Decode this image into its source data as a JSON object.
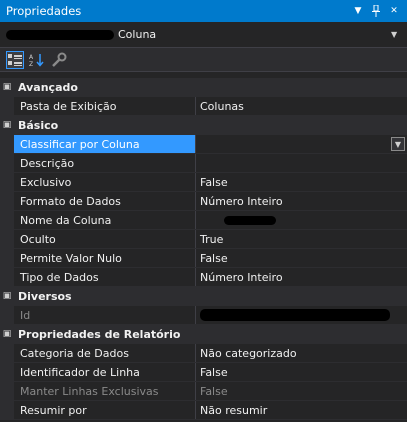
{
  "window": {
    "title": "Propriedades"
  },
  "selector": {
    "label": "Coluna"
  },
  "icons": {
    "pin": "pin-icon",
    "close": "close-icon",
    "dropdown": "chevron-down-icon",
    "categorized": "categorized-view-icon",
    "alphabetical": "alphabetical-sort-icon",
    "property_pages": "property-pages-icon"
  },
  "grid": {
    "avancado": {
      "label": "Avançado",
      "pasta_exibicao": {
        "name": "Pasta de Exibição",
        "value": "Colunas"
      }
    },
    "basico": {
      "label": "Básico",
      "classificar": {
        "name": "Classificar por Coluna",
        "value": ""
      },
      "descricao": {
        "name": "Descrição",
        "value": ""
      },
      "exclusivo": {
        "name": "Exclusivo",
        "value": "False"
      },
      "formato": {
        "name": "Formato de Dados",
        "value": "Número Inteiro"
      },
      "nome": {
        "name": "Nome da Coluna",
        "value": ""
      },
      "oculto": {
        "name": "Oculto",
        "value": "True"
      },
      "permite_nulo": {
        "name": "Permite Valor Nulo",
        "value": "False"
      },
      "tipo": {
        "name": "Tipo de Dados",
        "value": "Número Inteiro"
      }
    },
    "diversos": {
      "label": "Diversos",
      "id": {
        "name": "Id",
        "value": ""
      }
    },
    "relatorio": {
      "label": "Propriedades de Relatório",
      "categoria": {
        "name": "Categoria de Dados",
        "value": "Não categorizado"
      },
      "identificador": {
        "name": "Identificador de Linha",
        "value": "False"
      },
      "manter": {
        "name": "Manter Linhas Exclusivas",
        "value": "False"
      },
      "resumir": {
        "name": "Resumir por",
        "value": "Não resumir"
      }
    }
  },
  "colors": {
    "accent": "#007acc",
    "selection": "#3399ff",
    "background": "#252526"
  }
}
